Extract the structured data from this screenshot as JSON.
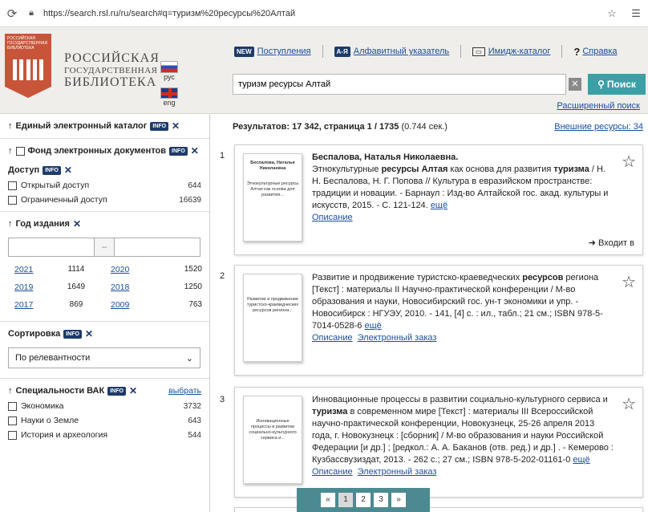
{
  "browser": {
    "url": "https://search.rsl.ru/ru/search#q=туризм%20ресурсы%20Алтай",
    "reload_icon": "reload-icon",
    "lock_icon": "lock-icon"
  },
  "logo": {
    "badge_text": "РОССИЙСКАЯ ГОСУДАРСТВЕННАЯ БИБЛИОТЕКА",
    "line1": "РОССИЙСКАЯ",
    "line2": "ГОСУДАРСТВЕННАЯ",
    "line3": "БИБЛИОТЕКА"
  },
  "lang": {
    "ru": "рус",
    "en": "eng"
  },
  "topnav": {
    "new_badge": "NEW",
    "arrivals": "Поступления",
    "az_badge": "А-Я",
    "alpha_index": "Алфавитный указатель",
    "image_catalog": "Имидж-каталог",
    "help_mark": "?",
    "help": "Справка"
  },
  "search": {
    "value": "туризм ресурсы Алтай",
    "clear": "✕",
    "button": "Поиск",
    "advanced": "Расширенный поиск"
  },
  "sidebar": {
    "catalog": "Единый электронный каталог",
    "fund": "Фонд электронных документов",
    "access": "Доступ",
    "info": "INFO",
    "access_items": [
      {
        "label": "Открытый доступ",
        "count": "644"
      },
      {
        "label": "Ограниченный доступ",
        "count": "16639"
      }
    ],
    "year_title": "Год издания",
    "range_dash": "–",
    "years": [
      {
        "year": "2021",
        "count": "1114"
      },
      {
        "year": "2020",
        "count": "1520"
      },
      {
        "year": "2019",
        "count": "1649"
      },
      {
        "year": "2018",
        "count": "1250"
      },
      {
        "year": "2017",
        "count": "869"
      },
      {
        "year": "2009",
        "count": "763"
      }
    ],
    "sort_title": "Сортировка",
    "sort_value": "По релевантности",
    "vak_title": "Специальности ВАК",
    "vak_select": "выбрать",
    "vak_items": [
      {
        "label": "Экономика",
        "count": "3732"
      },
      {
        "label": "Науки о Земле",
        "count": "643"
      },
      {
        "label": "История и археология",
        "count": "544"
      }
    ]
  },
  "results": {
    "header": "Результатов: 17 342, страница 1 / 1735",
    "time": "(0.744 сек.)",
    "external": "Внешние ресурсы: 34",
    "items": [
      {
        "num": "1",
        "thumb_title": "Беспалова, Наталья Николаевна",
        "thumb_body": "Этнокультурные ресурсы Алтая как основа для развития...",
        "author": "Беспалова, Наталья Николаевна.",
        "text_a": "Этнокультурные ",
        "hl1": "ресурсы Алтая",
        "text_b": " как основа для развития ",
        "hl2": "туризма",
        "text_c": " / Н. Н. Беспалова, Н. Г. Попова // Культура в евразийском пространстве: традиции и новации. - Барнаул : Изд-во Алтайской гос. акад. культуры и искусств, 2015. - С. 121-124.",
        "more": "ещё",
        "desc": "Описание",
        "goto": "Входит в"
      },
      {
        "num": "2",
        "thumb_body": "Развитие и продвижение туристско-краеведческих ресурсов региона...",
        "text_a": "Развитие и продвижение туристско-краеведческих ",
        "hl1": "ресурсов",
        "text_b": " региона [Текст] : материалы II Научно-практической конференции / М-во образования и науки, Новосибирский гос. ун-т экономики и упр. - Новосибирск : НГУЭУ, 2010. - 141, [4] с. : ил., табл.; 21 см.; ISBN 978-5-7014-0528-6",
        "more": "ещё",
        "desc": "Описание",
        "order": "Электронный заказ"
      },
      {
        "num": "3",
        "thumb_body": "Инновационные процессы в развитии социально-культурного сервиса и...",
        "text_a": "Инновационные процессы в развитии социально-культурного сервиса и ",
        "hl1": "туризма",
        "text_b": " в современном мире [Текст] : материалы III Всероссийской научно-практической конференции, Новокузнецк, 25-26 апреля 2013 года, г. Новокузнецк : [сборник] / М-во образования и науки Российской Федерации [и др.] ; [редкол.: А. А. Баканов (отв. ред.) и др.] . - Кемерово : Кузбассвузиздат, 2013. - 262 с.; 27 см.; ISBN 978-5-202-01161-0",
        "more": "ещё",
        "desc": "Описание",
        "order": "Электронный заказ"
      }
    ]
  },
  "pager": {
    "prev": "«",
    "p1": "1",
    "p2": "2",
    "p3": "3",
    "next": "»"
  }
}
